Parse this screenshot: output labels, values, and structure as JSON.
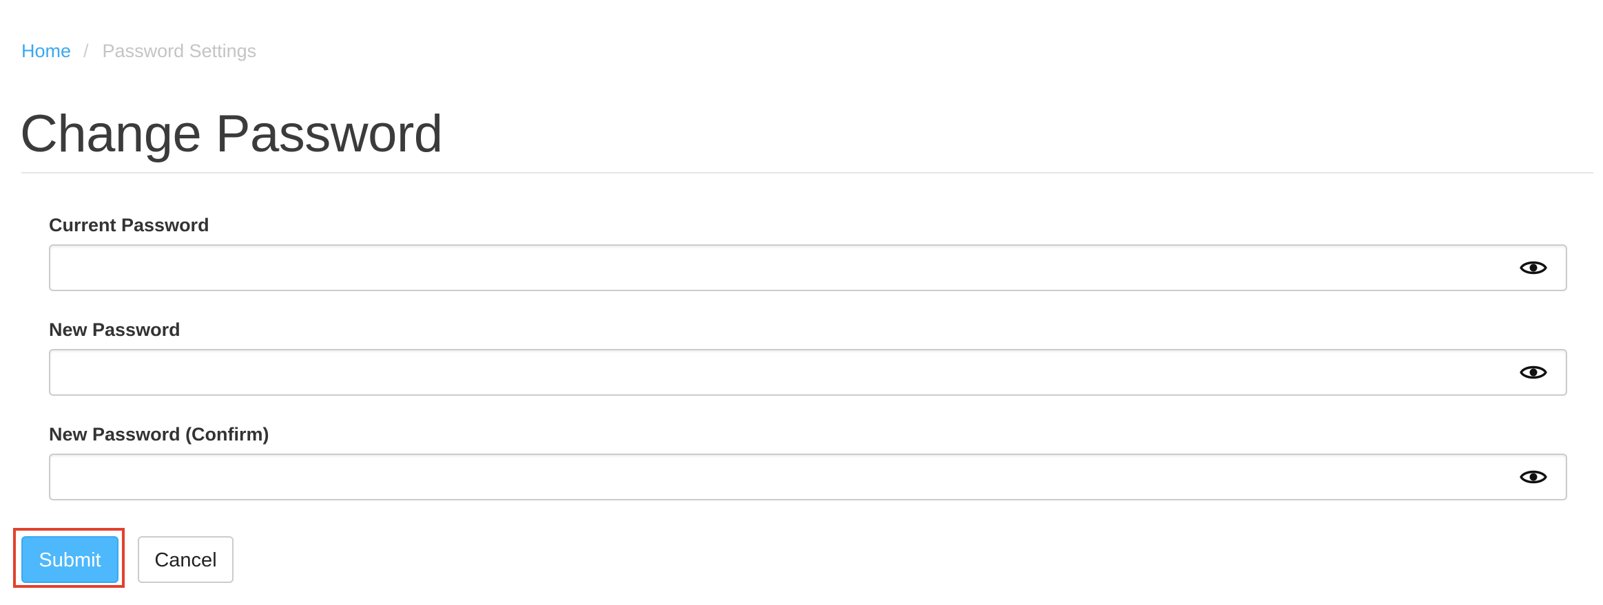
{
  "breadcrumb": {
    "home": "Home",
    "separator": "/",
    "current": "Password Settings"
  },
  "page": {
    "title": "Change Password"
  },
  "form": {
    "current_password": {
      "label": "Current Password",
      "value": "",
      "placeholder": "",
      "toggle_icon": "eye-icon"
    },
    "new_password": {
      "label": "New Password",
      "value": "",
      "placeholder": "",
      "toggle_icon": "eye-icon"
    },
    "confirm_password": {
      "label": "New Password (Confirm)",
      "value": "",
      "placeholder": "",
      "toggle_icon": "eye-icon"
    }
  },
  "actions": {
    "submit_label": "Submit",
    "cancel_label": "Cancel"
  },
  "colors": {
    "link": "#3aa9f0",
    "primary_button": "#4db8fb",
    "highlight": "#e2412d",
    "text": "#333333"
  }
}
